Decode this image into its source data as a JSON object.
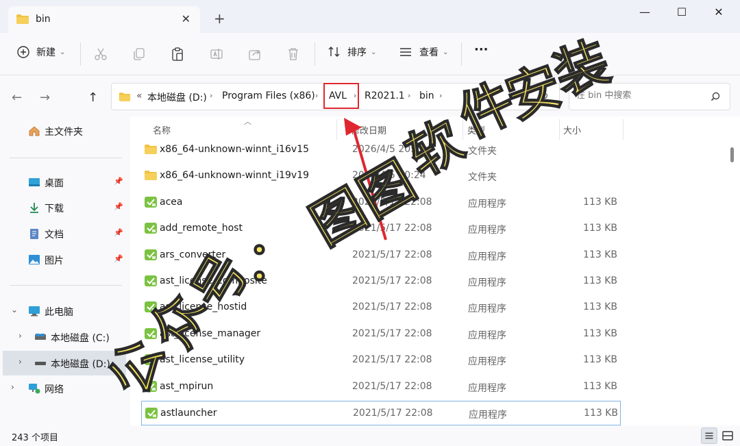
{
  "window": {
    "tab_title": "bin",
    "tab_close": "✕",
    "new_tab": "+",
    "minimize": "—",
    "maximize": "☐",
    "close": "✕"
  },
  "toolbar": {
    "new_label": "新建",
    "sort_label": "排序",
    "view_label": "查看",
    "more_label": "···"
  },
  "address": {
    "overflow": "«",
    "crumbs": [
      "本地磁盘 (D:)",
      "Program Files (x86)",
      "AVL",
      "R2021.1",
      "bin"
    ],
    "search_placeholder": "在 bin 中搜索"
  },
  "sidebar": {
    "home": "主文件夹",
    "quick": [
      {
        "label": "桌面"
      },
      {
        "label": "下载"
      },
      {
        "label": "文档"
      },
      {
        "label": "图片"
      }
    ],
    "this_pc": "此电脑",
    "drives": [
      {
        "label": "本地磁盘 (C:)"
      },
      {
        "label": "本地磁盘 (D:)"
      }
    ],
    "network": "网络"
  },
  "columns": {
    "name": "名称",
    "date": "修改日期",
    "type": "类型",
    "size": "大小"
  },
  "files": [
    {
      "name": "x86_64-unknown-winnt_i16v15",
      "date": "2026/4/5 20:24",
      "type": "文件夹",
      "size": "",
      "kind": "folder"
    },
    {
      "name": "x86_64-unknown-winnt_i19v19",
      "date": "2026/4/5 20:24",
      "type": "文件夹",
      "size": "",
      "kind": "folder"
    },
    {
      "name": "acea",
      "date": "2021/5/17 22:08",
      "type": "应用程序",
      "size": "113 KB",
      "kind": "app"
    },
    {
      "name": "add_remote_host",
      "date": "2021/5/17 22:08",
      "type": "应用程序",
      "size": "113 KB",
      "kind": "app"
    },
    {
      "name": "ars_converter",
      "date": "2021/5/17 22:08",
      "type": "应用程序",
      "size": "113 KB",
      "kind": "app"
    },
    {
      "name": "ast_license_composite",
      "date": "2021/5/17 22:08",
      "type": "应用程序",
      "size": "113 KB",
      "kind": "app"
    },
    {
      "name": "ast_license_hostid",
      "date": "2021/5/17 22:08",
      "type": "应用程序",
      "size": "113 KB",
      "kind": "app"
    },
    {
      "name": "ast_license_manager",
      "date": "2021/5/17 22:08",
      "type": "应用程序",
      "size": "113 KB",
      "kind": "app"
    },
    {
      "name": "ast_license_utility",
      "date": "2021/5/17 22:08",
      "type": "应用程序",
      "size": "113 KB",
      "kind": "app"
    },
    {
      "name": "ast_mpirun",
      "date": "2021/5/17 22:08",
      "type": "应用程序",
      "size": "113 KB",
      "kind": "app"
    },
    {
      "name": "astlauncher",
      "date": "2021/5/17 22:08",
      "type": "应用程序",
      "size": "113 KB",
      "kind": "app"
    }
  ],
  "status": {
    "item_count": "243 个项目"
  },
  "watermark": {
    "text": "公众号：图图软件安装"
  },
  "colors": {
    "folder": "#f0c243",
    "app": "#7cc242",
    "highlight_box": "#e0262e",
    "watermark_fill": "#f5e04a"
  }
}
